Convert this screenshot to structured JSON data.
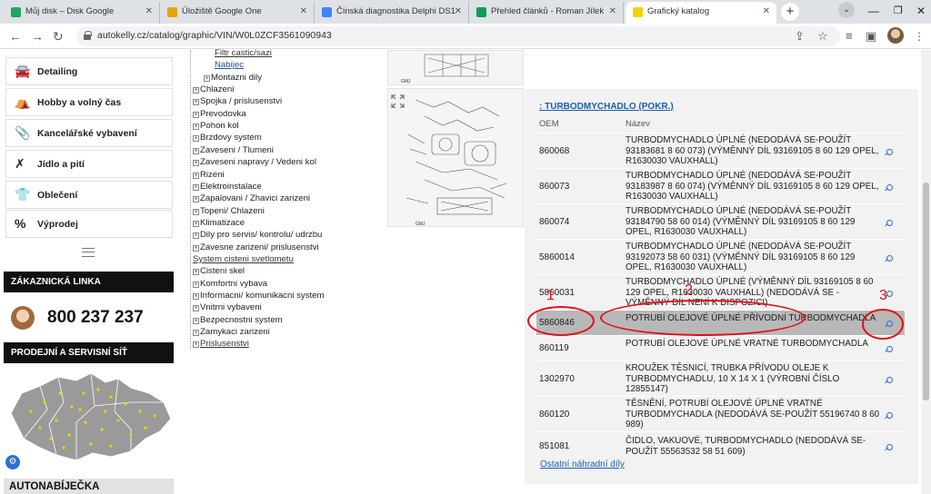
{
  "browser": {
    "tabs": [
      {
        "title": "Můj disk – Disk Google",
        "color": "#1fa463"
      },
      {
        "title": "Úložiště Google One",
        "color": "#e8a20c"
      },
      {
        "title": "Čínská diagnostika Delphi DS1",
        "color": "#4285f4"
      },
      {
        "title": "Přehled článků - Roman Jílek",
        "color": "#0f9d58"
      },
      {
        "title": "Grafický katalog",
        "color": "#f4d000"
      }
    ],
    "new_tab": "+",
    "url": "autokelly.cz/catalog/graphic/VIN/W0L0ZCF3561090943"
  },
  "sidebar": {
    "items": [
      {
        "label": "Detailing",
        "icon": "car-wash-icon",
        "glyph": "🚘"
      },
      {
        "label": "Hobby a volný čas",
        "icon": "tent-icon",
        "glyph": "⛺"
      },
      {
        "label": "Kancelářské vybavení",
        "icon": "paperclip-icon",
        "glyph": "📎"
      },
      {
        "label": "Jídlo a pití",
        "icon": "cutlery-icon",
        "glyph": "✗"
      },
      {
        "label": "Oblečení",
        "icon": "tshirt-icon",
        "glyph": "👕"
      },
      {
        "label": "Výprodej",
        "icon": "sale-icon",
        "glyph": "%"
      }
    ],
    "customer_line": "ZÁKAZNICKÁ LINKA",
    "phone": "800 237 237",
    "sales_network": "PRODEJNÍ A SERVISNÍ SÍŤ",
    "autobar": "AUTONABÍJEČKA"
  },
  "tree": [
    {
      "label": "Filtr castic/sazi",
      "style": "lnk",
      "indent": 2,
      "pm": ""
    },
    {
      "label": "Nabijec",
      "style": "blue",
      "indent": 2,
      "pm": ""
    },
    {
      "label": "Montazni dily",
      "style": "",
      "indent": 1,
      "pm": "+"
    },
    {
      "label": "Chlazeni",
      "style": "",
      "indent": 0,
      "pm": "+"
    },
    {
      "label": "Spojka / prislusenstvi",
      "style": "",
      "indent": 0,
      "pm": "+"
    },
    {
      "label": "Prevodovka",
      "style": "",
      "indent": 0,
      "pm": "+"
    },
    {
      "label": "Pohon kol",
      "style": "",
      "indent": 0,
      "pm": "+"
    },
    {
      "label": "Brzdovy system",
      "style": "",
      "indent": 0,
      "pm": "+"
    },
    {
      "label": "Zaveseni / Tlumeni",
      "style": "",
      "indent": 0,
      "pm": "+"
    },
    {
      "label": "Zaveseni napravy / Vedeni kol",
      "style": "",
      "indent": 0,
      "pm": "+"
    },
    {
      "label": "Rizeni",
      "style": "",
      "indent": 0,
      "pm": "+"
    },
    {
      "label": "Elektroinstalace",
      "style": "",
      "indent": 0,
      "pm": "+"
    },
    {
      "label": "Zapalovani / Zhavici zarizeni",
      "style": "",
      "indent": 0,
      "pm": "+"
    },
    {
      "label": "Topeni/ Chlazeni",
      "style": "",
      "indent": 0,
      "pm": "+"
    },
    {
      "label": "Klimatizace",
      "style": "",
      "indent": 0,
      "pm": "+"
    },
    {
      "label": "Dily pro servis/ kontrolu/ udrzbu",
      "style": "",
      "indent": 0,
      "pm": "+"
    },
    {
      "label": "Zavesne zarizeni/ prislusenstvi",
      "style": "",
      "indent": 0,
      "pm": "+"
    },
    {
      "label": "System cisteni svetlometu",
      "style": "lnk",
      "indent": 0,
      "pm": ""
    },
    {
      "label": "Cisteni skel",
      "style": "",
      "indent": 0,
      "pm": "+"
    },
    {
      "label": "Komfortni vybava",
      "style": "",
      "indent": 0,
      "pm": "+"
    },
    {
      "label": "Informacni/ komunikacni system",
      "style": "",
      "indent": 0,
      "pm": "+"
    },
    {
      "label": "Vnitrni vybaveni",
      "style": "",
      "indent": 0,
      "pm": "+"
    },
    {
      "label": "Bezpecnostni system",
      "style": "",
      "indent": 0,
      "pm": "+"
    },
    {
      "label": "Zamykaci zarizeni",
      "style": "",
      "indent": 0,
      "pm": "+"
    },
    {
      "label": "Prislusenstvi",
      "style": "lnk",
      "indent": 0,
      "pm": "+"
    }
  ],
  "diagrams": [
    {
      "code": "GMJ"
    },
    {
      "code": "GMJ"
    }
  ],
  "parts": {
    "title": ": TURBODMYCHADLO (POKR.)",
    "col_oem": "OEM",
    "col_name": "Název",
    "rows": [
      {
        "oem": "860068",
        "name": "TURBODMYCHADLO ÚPLNÉ (NEDODÁVÁ SE-POUŽÍT 93183681 8 60 073) (VÝMĚNNÝ DÍL 93169105 8 60 129 OPEL, R1630030 VAUXHALL)",
        "selected": false
      },
      {
        "oem": "860073",
        "name": "TURBODMYCHADLO ÚPLNÉ (NEDODÁVÁ SE-POUŽÍT 93183987 8 60 074) (VÝMĚNNÝ DÍL 93169105 8 60 129 OPEL, R1630030 VAUXHALL)",
        "selected": false
      },
      {
        "oem": "860074",
        "name": "TURBODMYCHADLO ÚPLNÉ (NEDODÁVÁ SE-POUŽÍT 93184790 58 60 014) (VÝMĚNNÝ DÍL 93169105 8 60 129 OPEL, R1630030 VAUXHALL)",
        "selected": false
      },
      {
        "oem": "5860014",
        "name": "TURBODMYCHADLO ÚPLNÉ (NEDODÁVÁ SE-POUŽÍT 93192073 58 60 031) (VÝMĚNNÝ DÍL 93169105 8 60 129 OPEL, R1630030 VAUXHALL)",
        "selected": false
      },
      {
        "oem": "5860031",
        "name": "TURBODMYCHADLO ÚPLNÉ (VÝMĚNNÝ DÍL 93169105 8 60 129 OPEL, R1630030 VAUXHALL) (NEDODÁVÁ SE - VÝMĚNNÝ DÍL NENÍ K DISPOZICI)",
        "selected": false
      },
      {
        "oem": "5860846",
        "name": "POTRUBÍ OLEJOVÉ ÚPLNÉ PŘÍVODNÍ TURBODMYCHADLA",
        "selected": true
      },
      {
        "oem": "860119",
        "name": "POTRUBÍ OLEJOVÉ ÚPLNÉ VRATNÉ TURBODMYCHADLA",
        "selected": false
      },
      {
        "oem": "1302970",
        "name": "KROUŽEK TĚSNICÍ, TRUBKA PŘÍVODU OLEJE K TURBODMYCHADLU, 10 X 14 X 1 (VÝROBNÍ ČÍSLO 12855147)",
        "selected": false
      },
      {
        "oem": "860120",
        "name": "TĚSNĚNÍ, POTRUBÍ OLEJOVÉ ÚPLNÉ VRATNÉ TURBODMYCHADLA (NEDODÁVÁ SE-POUŽÍT 55196740 8 60 989)",
        "selected": false
      },
      {
        "oem": "851081",
        "name": "ČIDLO, VAKUOVÉ, TURBODMYCHADLO (NEDODÁVÁ SE-POUŽÍT 55563532 58 51 609)",
        "selected": false
      }
    ],
    "other_link": "Ostatní náhradní díly"
  },
  "annotations": {
    "n1": "1",
    "n2": "2",
    "n3": "3",
    "color": "#e0101a"
  }
}
